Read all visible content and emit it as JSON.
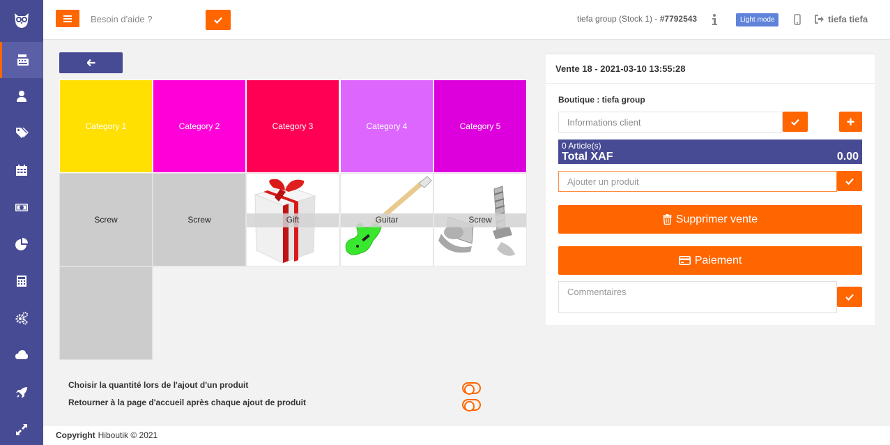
{
  "header": {
    "help_placeholder": "Besoin d'aide ?",
    "store_label": "tiefa group (Stock 1) - ",
    "store_id": "#7792543",
    "light_mode_label": "Light mode",
    "user_name": "tiefa tiefa"
  },
  "sidebar": {
    "items": [
      {
        "icon": "cash-register-icon",
        "active": true
      },
      {
        "icon": "user-icon"
      },
      {
        "icon": "tags-icon"
      },
      {
        "icon": "calendar-icon"
      },
      {
        "icon": "money-bill-icon"
      },
      {
        "icon": "pie-chart-icon"
      },
      {
        "icon": "calculator-icon"
      },
      {
        "icon": "cogs-icon"
      },
      {
        "icon": "cloud-icon"
      },
      {
        "icon": "rocket-icon"
      },
      {
        "icon": "expand-icon"
      }
    ]
  },
  "categories": [
    {
      "label": "Category 1",
      "color": "#ffe000"
    },
    {
      "label": "Category 2",
      "color": "#ff00d9"
    },
    {
      "label": "Category 3",
      "color": "#ff0055"
    },
    {
      "label": "Category 4",
      "color": "#dd66ff"
    },
    {
      "label": "Category 5",
      "color": "#dd00dd"
    }
  ],
  "products": [
    {
      "label": "Screw",
      "image": "none"
    },
    {
      "label": "Screw",
      "image": "none"
    },
    {
      "label": "Gift",
      "image": "gift-image"
    },
    {
      "label": "Guitar",
      "image": "guitar-image"
    },
    {
      "label": "Screw",
      "image": "screw-image"
    }
  ],
  "options": {
    "choose_quantity": "Choisir la quantité lors de l'ajout d'un produit",
    "return_home": "Retourner à la page d'accueil après chaque ajout de produit"
  },
  "footer": {
    "copyright_label": "Copyright",
    "copyright_text": "Hiboutik © 2021"
  },
  "sale": {
    "title": "Vente 18 - 2021-03-10 13:55:28",
    "boutique": "Boutique : tiefa group",
    "client_placeholder": "Informations client",
    "articles": "0 Article(s)",
    "total_label": "Total XAF",
    "total_value": "0.00",
    "product_placeholder": "Ajouter un produit",
    "delete_label": "Supprimer vente",
    "pay_label": "Paiement",
    "comment_placeholder": "Commentaires"
  },
  "colors": {
    "accent": "#ff6600",
    "primary": "#474b94"
  }
}
